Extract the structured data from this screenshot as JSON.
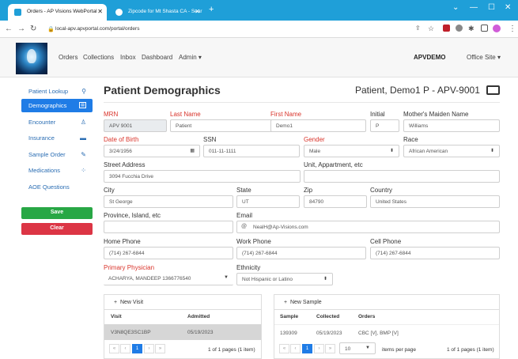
{
  "browser": {
    "tabs": [
      {
        "title": "Orders - AP Visions WebPortal"
      },
      {
        "title": "Zipcode for Mt Shasta CA - Sear"
      }
    ],
    "new_tab": "+",
    "url": "local-apv.apvportal.com/portal/orders"
  },
  "nav": {
    "links": [
      "Orders",
      "Collections",
      "Inbox",
      "Dashboard",
      "Admin ▾"
    ],
    "user": "APVDEMO",
    "site": "Office Site ▾"
  },
  "sidebar": {
    "items": [
      {
        "label": "Patient Lookup",
        "icon": "search-icon"
      },
      {
        "label": "Demographics",
        "icon": "id-card-icon"
      },
      {
        "label": "Encounter",
        "icon": "user-icon"
      },
      {
        "label": "Insurance",
        "icon": "card-icon"
      },
      {
        "label": "Sample Order",
        "icon": "syringe-icon"
      },
      {
        "label": "Medications",
        "icon": "pills-icon"
      },
      {
        "label": "AOE Questions",
        "icon": ""
      }
    ],
    "save": "Save",
    "clear": "Clear",
    "colors": {
      "save": "#28a745",
      "clear": "#dc3545",
      "active": "#1f7ce6"
    }
  },
  "page": {
    "title": "Patient Demographics",
    "patient": "Patient, Demo1 P - APV-9001"
  },
  "form": {
    "mrn": {
      "label": "MRN",
      "value": "APV 9001"
    },
    "last_name": {
      "label": "Last Name",
      "value": "Patient"
    },
    "first_name": {
      "label": "First Name",
      "value": "Demo1"
    },
    "initial": {
      "label": "Initial",
      "value": "P"
    },
    "maiden": {
      "label": "Mother's Maiden Name",
      "value": "Williams"
    },
    "dob": {
      "label": "Date of Birth",
      "value": "3/24/1956"
    },
    "ssn": {
      "label": "SSN",
      "value": "011-11-1111"
    },
    "gender": {
      "label": "Gender",
      "value": "Male"
    },
    "race": {
      "label": "Race",
      "value": "African American"
    },
    "street": {
      "label": "Street Address",
      "value": "3094 Fucchia Drive"
    },
    "unit": {
      "label": "Unit, Appartment, etc",
      "value": ""
    },
    "city": {
      "label": "City",
      "value": "St George"
    },
    "state": {
      "label": "State",
      "value": "UT"
    },
    "zip": {
      "label": "Zip",
      "value": "84790"
    },
    "country": {
      "label": "Country",
      "value": "United States"
    },
    "province": {
      "label": "Province, Island, etc",
      "value": ""
    },
    "email": {
      "label": "Email",
      "value": "NealH@Ap-Visions.com"
    },
    "home_phone": {
      "label": "Home Phone",
      "value": "(714) 267-6844"
    },
    "work_phone": {
      "label": "Work Phone",
      "value": "(714) 267-6844"
    },
    "cell_phone": {
      "label": "Cell Phone",
      "value": "(714) 267-6844"
    },
    "physician": {
      "label": "Primary Physician",
      "value": "ACHARYA, MANDEEP 1366776540"
    },
    "ethnicity": {
      "label": "Ethnicity",
      "value": "Not Hispanic or Latino"
    }
  },
  "visits": {
    "add": "New Visit",
    "columns": [
      "Visit",
      "Admitted"
    ],
    "rows": [
      [
        "V3N8QE3SC1BP",
        "05/19/2023"
      ]
    ],
    "page": "1",
    "pager_text": "1 of 1 pages (1 item)"
  },
  "samples": {
    "add": "New Sample",
    "columns": [
      "Sample",
      "Collected",
      "Orders"
    ],
    "rows": [
      [
        "139309",
        "05/19/2023",
        "CBC [V], BMP [V]"
      ]
    ],
    "page": "1",
    "per_page": "10",
    "per_page_label": "items per page",
    "pager_text": "1 of 1 pages (1 item)"
  }
}
